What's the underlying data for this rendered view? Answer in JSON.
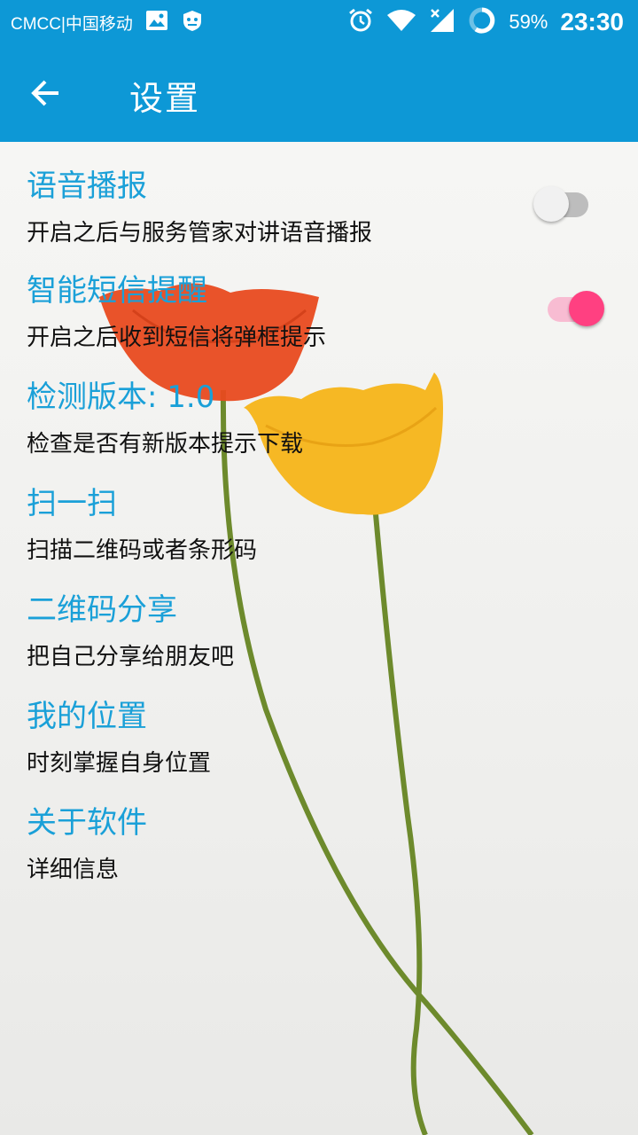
{
  "status_bar": {
    "carrier": "CMCC|中国移动",
    "battery_percent": "59%",
    "time": "23:30",
    "icons": [
      "image-icon",
      "android-robot-icon",
      "alarm-icon",
      "wifi-icon",
      "signal-icon",
      "battery-ring-icon"
    ]
  },
  "app_bar": {
    "title": "设置",
    "back_icon": "arrow-back-icon",
    "color": "#0d98d6"
  },
  "settings": {
    "voice": {
      "title": "语音播报",
      "subtitle": "开启之后与服务管家对讲语音播报",
      "switch_on": false
    },
    "sms": {
      "title": "智能短信提醒",
      "subtitle": "开启之后收到短信将弹框提示",
      "switch_on": true
    },
    "version": {
      "title": "检测版本: 1.0",
      "subtitle": "检查是否有新版本提示下载"
    },
    "scan": {
      "title": "扫一扫",
      "subtitle": "扫描二维码或者条形码"
    },
    "qr_share": {
      "title": "二维码分享",
      "subtitle": "把自己分享给朋友吧"
    },
    "location": {
      "title": "我的位置",
      "subtitle": "时刻掌握自身位置"
    },
    "about": {
      "title": "关于软件",
      "subtitle": "详细信息"
    }
  },
  "colors": {
    "accent_title": "#1aa0d8",
    "switch_on": "#ff4081",
    "switch_off": "#bdbdbd"
  }
}
